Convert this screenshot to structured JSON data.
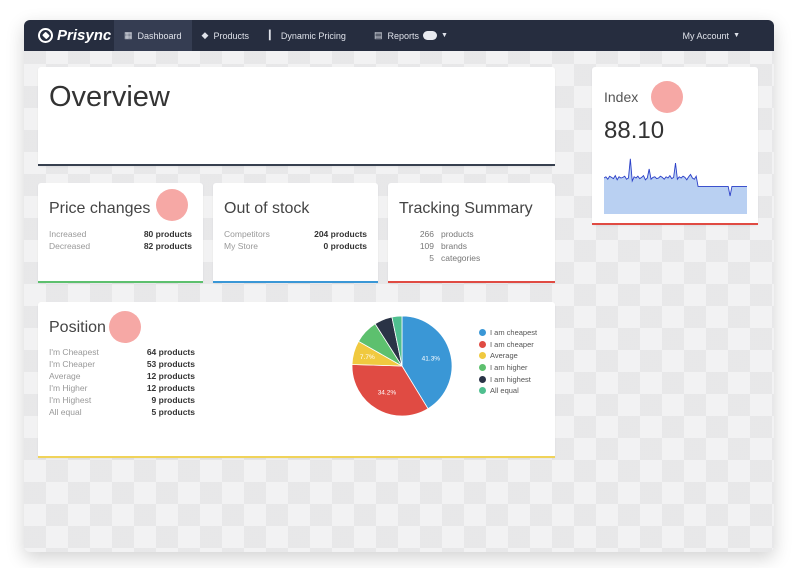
{
  "navbar": {
    "brand": "Prisync",
    "items": [
      {
        "label": "Dashboard",
        "icon": "grid-icon",
        "active": true
      },
      {
        "label": "Products",
        "icon": "tag-icon",
        "active": false
      },
      {
        "label": "Dynamic Pricing",
        "icon": "bar-chart-icon",
        "active": false
      },
      {
        "label": "Reports",
        "icon": "report-icon",
        "active": false
      }
    ],
    "account": "My Account"
  },
  "overview": {
    "title": "Overview"
  },
  "price_changes": {
    "title": "Price changes",
    "rows": [
      {
        "label": "Increased",
        "value": "80 products"
      },
      {
        "label": "Decreased",
        "value": "82 products"
      }
    ]
  },
  "out_of_stock": {
    "title": "Out of stock",
    "rows": [
      {
        "label": "Competitors",
        "value": "204 products"
      },
      {
        "label": "My Store",
        "value": "0 products"
      }
    ]
  },
  "tracking": {
    "title": "Tracking Summary",
    "rows": [
      {
        "count": "266",
        "label": "products"
      },
      {
        "count": "109",
        "label": "brands"
      },
      {
        "count": "5",
        "label": "categories"
      }
    ]
  },
  "position": {
    "title": "Position",
    "rows": [
      {
        "label": "I'm Cheapest",
        "value": "64 products"
      },
      {
        "label": "I'm Cheaper",
        "value": "53 products"
      },
      {
        "label": "Average",
        "value": "12 products"
      },
      {
        "label": "I'm Higher",
        "value": "12 products"
      },
      {
        "label": "I'm Highest",
        "value": "9 products"
      },
      {
        "label": "All equal",
        "value": "5 products"
      }
    ]
  },
  "index": {
    "label": "Index",
    "value": "88.10"
  },
  "chart_data": [
    {
      "type": "pie",
      "title": "Position",
      "categories": [
        "I am cheapest",
        "I am cheaper",
        "Average",
        "I am higher",
        "I am highest",
        "All equal"
      ],
      "values": [
        64,
        53,
        12,
        12,
        9,
        5
      ],
      "data_labels": [
        "41.3%",
        "34.2%",
        "7.7%",
        "",
        "",
        ""
      ],
      "colors": [
        "#3a97d6",
        "#e04b43",
        "#f0c93f",
        "#5dc06e",
        "#2a3346",
        "#4fbf8f"
      ],
      "legend": "right"
    },
    {
      "type": "area",
      "title": "Index",
      "series": [
        {
          "name": "Index",
          "values": [
            60,
            62,
            58,
            63,
            61,
            59,
            64,
            57,
            62,
            60,
            61,
            63,
            58,
            60,
            92,
            55,
            62,
            60,
            63,
            59,
            61,
            64,
            57,
            60,
            75,
            58,
            61,
            62,
            59,
            60,
            63,
            61,
            58,
            62,
            60,
            64,
            59,
            61,
            85,
            58,
            62,
            60,
            63,
            61,
            57,
            62,
            66,
            60,
            58,
            63,
            46,
            46,
            46,
            46,
            46,
            46,
            46,
            46,
            46,
            46,
            46,
            46,
            46,
            46,
            46,
            46,
            46,
            30,
            46,
            46,
            46,
            46,
            46,
            46,
            46,
            46,
            46
          ]
        }
      ],
      "color": "#2b3fc8",
      "fill": "#b9d0f2"
    }
  ]
}
